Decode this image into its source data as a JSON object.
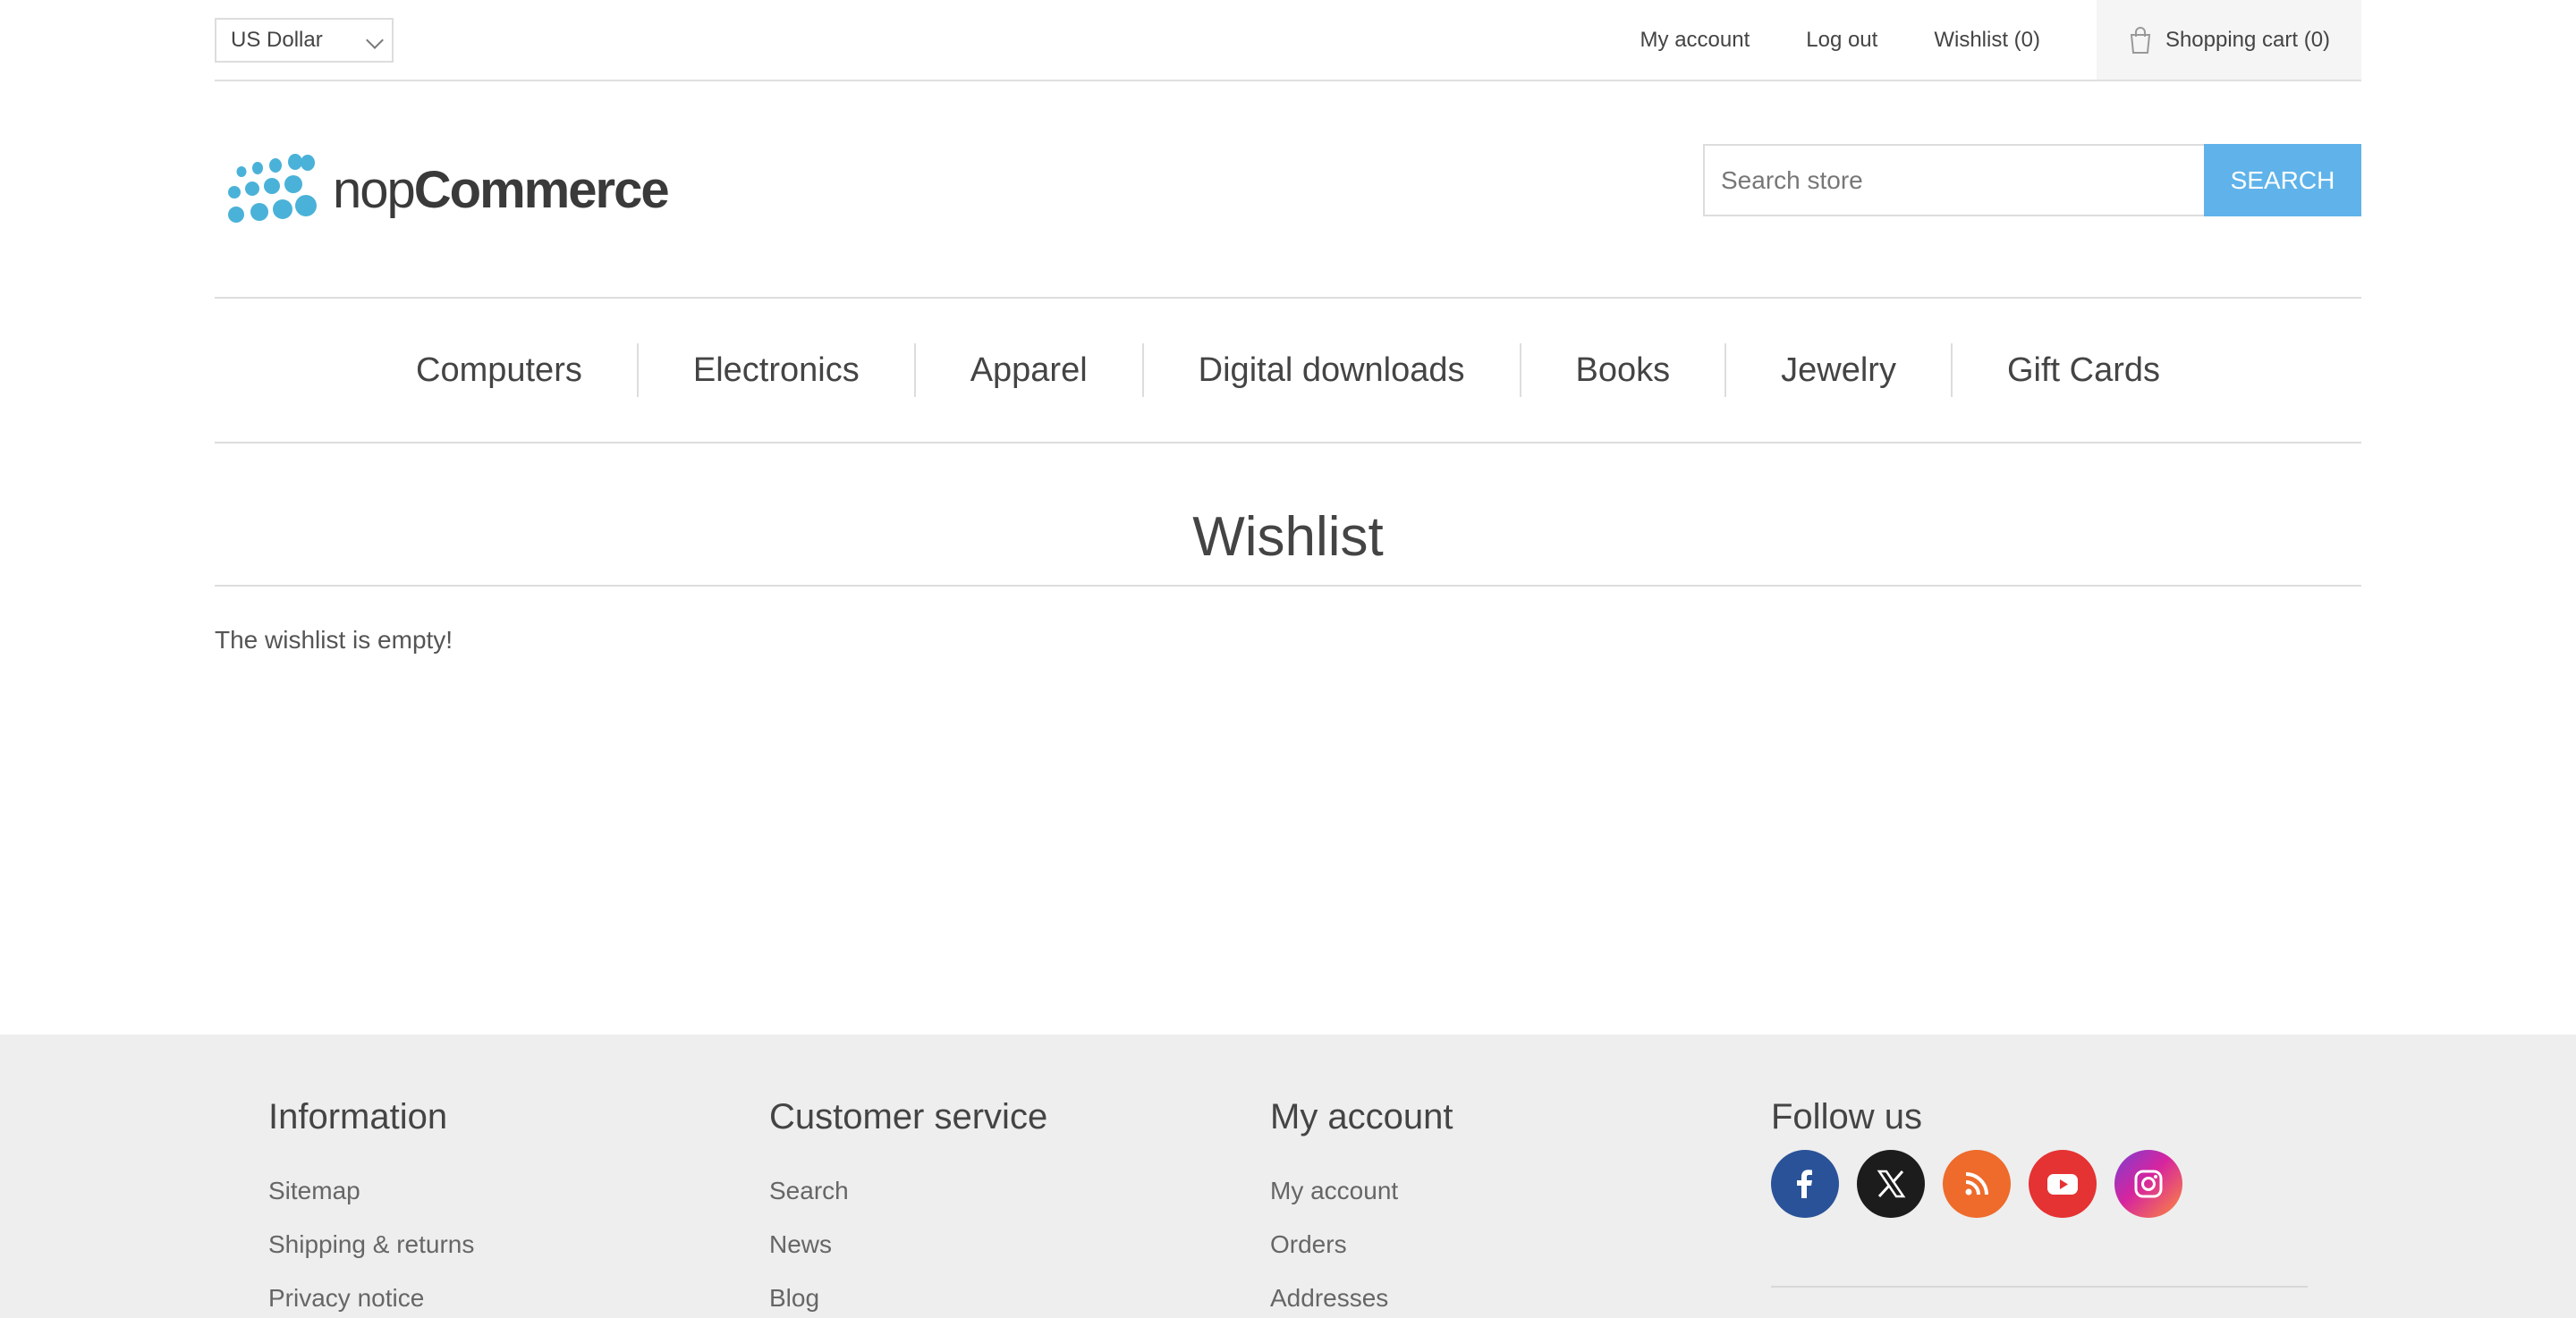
{
  "header": {
    "currency": "US Dollar",
    "links": [
      "My account",
      "Log out",
      "Wishlist (0)"
    ],
    "cart": "Shopping cart (0)"
  },
  "logo": {
    "light": "nop",
    "bold": "Commerce"
  },
  "search": {
    "placeholder": "Search store",
    "button": "SEARCH"
  },
  "menu": [
    "Computers",
    "Electronics",
    "Apparel",
    "Digital downloads",
    "Books",
    "Jewelry",
    "Gift Cards"
  ],
  "main": {
    "title": "Wishlist",
    "message": "The wishlist is empty!"
  },
  "footer": {
    "information": {
      "title": "Information",
      "links": [
        "Sitemap",
        "Shipping & returns",
        "Privacy notice"
      ]
    },
    "customer_service": {
      "title": "Customer service",
      "links": [
        "Search",
        "News",
        "Blog"
      ]
    },
    "my_account": {
      "title": "My account",
      "links": [
        "My account",
        "Orders",
        "Addresses"
      ]
    },
    "follow_us": {
      "title": "Follow us",
      "icons": [
        "facebook-icon",
        "x-icon",
        "rss-icon",
        "youtube-icon",
        "instagram-icon"
      ]
    }
  },
  "colors": {
    "accent": "#5fb3ea",
    "footer_bg": "#eeeeee"
  }
}
